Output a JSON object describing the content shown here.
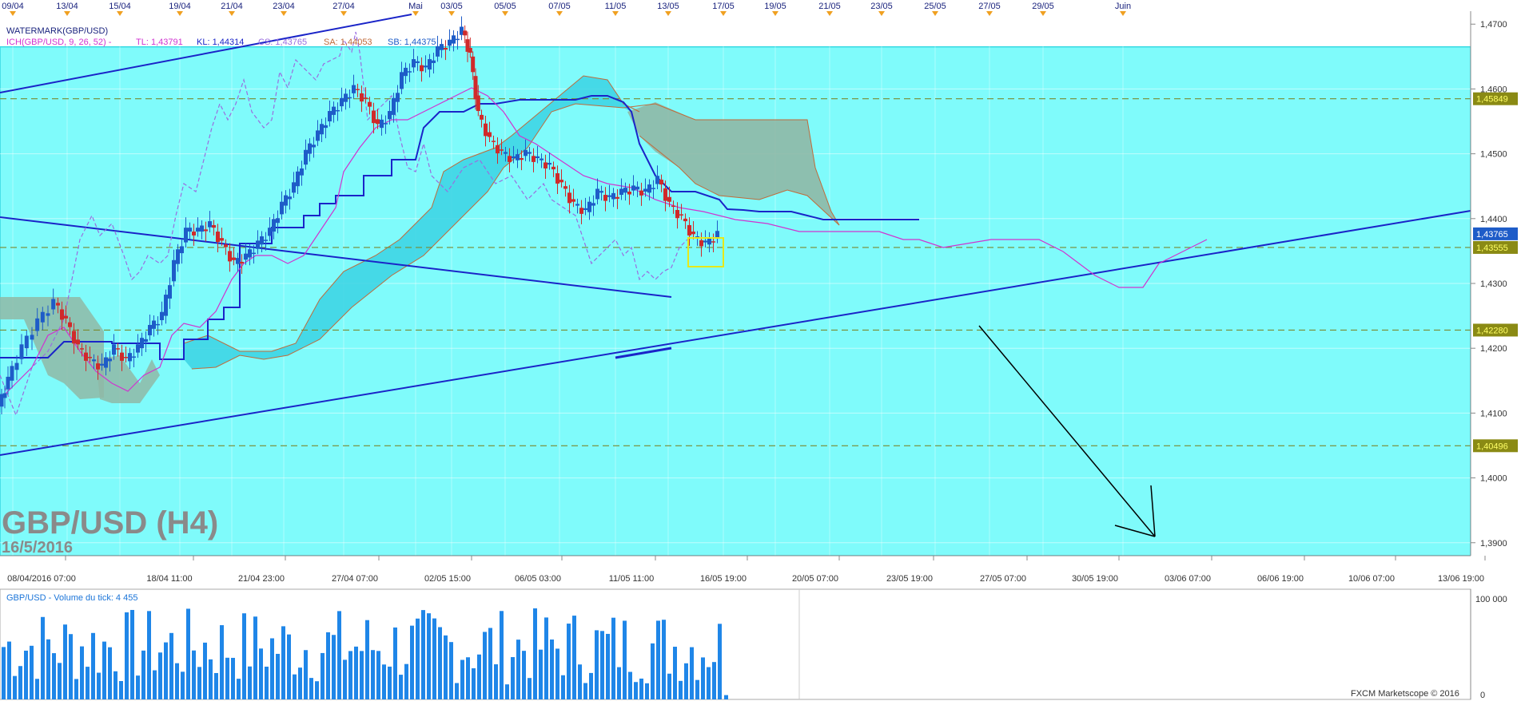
{
  "header": {
    "watermark_label": "WATERMARK(GBP/USD)",
    "ichimoku_params": "ICH(GBP/USD, 9, 26, 52) -",
    "tl": "TL: 1,43791",
    "kl": "KL: 1,44314",
    "cs": "CS: 1,43765",
    "sa": "SA: 1,44053",
    "sb": "SB: 1,44375"
  },
  "overlay": {
    "symbol_title": "GBP/USD (H4)",
    "date": "16/5/2016"
  },
  "top_dates": [
    "09/04",
    "13/04",
    "15/04",
    "19/04",
    "21/04",
    "23/04",
    "27/04",
    "Mai",
    "03/05",
    "05/05",
    "07/05",
    "11/05",
    "13/05",
    "17/05",
    "19/05",
    "21/05",
    "23/05",
    "25/05",
    "27/05",
    "29/05",
    "Juin"
  ],
  "price_ticks": [
    "1,4700",
    "1,4600",
    "1,4500",
    "1,4400",
    "1,4300",
    "1,4200",
    "1,4100",
    "1,4000",
    "1,3900"
  ],
  "time_ticks": [
    "08/04/2016 07:00",
    "18/04 11:00",
    "21/04 23:00",
    "27/04 07:00",
    "02/05 15:00",
    "06/05 03:00",
    "11/05 11:00",
    "16/05 19:00",
    "20/05 07:00",
    "23/05 19:00",
    "27/05 07:00",
    "30/05 19:00",
    "03/06 07:00",
    "06/06 19:00",
    "10/06 07:00",
    "13/06 19:00"
  ],
  "level_labels": [
    "1,45849",
    "1,43765",
    "1,43555",
    "1,42280",
    "1,40496"
  ],
  "volume": {
    "title": "GBP/USD - Volume du tick: 4 455",
    "max_label": "100 000",
    "zero_label": "0"
  },
  "footer": {
    "copyright": "FXCM Marketscope © 2016"
  },
  "colors": {
    "zone": "#7ffbfb",
    "zone_border": "#36d8e2",
    "trendline": "#1a24c8",
    "kijun": "#1a24c8",
    "tenkan": "#d033d0",
    "chikou": "#9a6de0",
    "cloud_bull": "#3bd2e3",
    "cloud_bear": "#8fb8a6",
    "bull_candle": "#1e5cc8",
    "bear_candle": "#d02a2a",
    "volume_bar": "#1f86e8",
    "level_line": "#7a8a30",
    "level_label_bg": "#8a8a14",
    "arrow": "#000000"
  },
  "chart_data": {
    "type": "candlestick",
    "symbol": "GBP/USD",
    "timeframe": "H4",
    "ylim": [
      1.388,
      1.472
    ],
    "horizontal_levels": [
      1.45849,
      1.43555,
      1.4228,
      1.40496
    ],
    "last_price": 1.43765,
    "zone": [
      1.388,
      1.4665
    ],
    "indicators": {
      "tenkan": 1.43791,
      "kijun": 1.44314,
      "chikou": 1.43765,
      "senkou_a": 1.44053,
      "senkou_b": 1.44375
    },
    "volume_axis": [
      0,
      100000
    ],
    "last_volume": 4455
  }
}
